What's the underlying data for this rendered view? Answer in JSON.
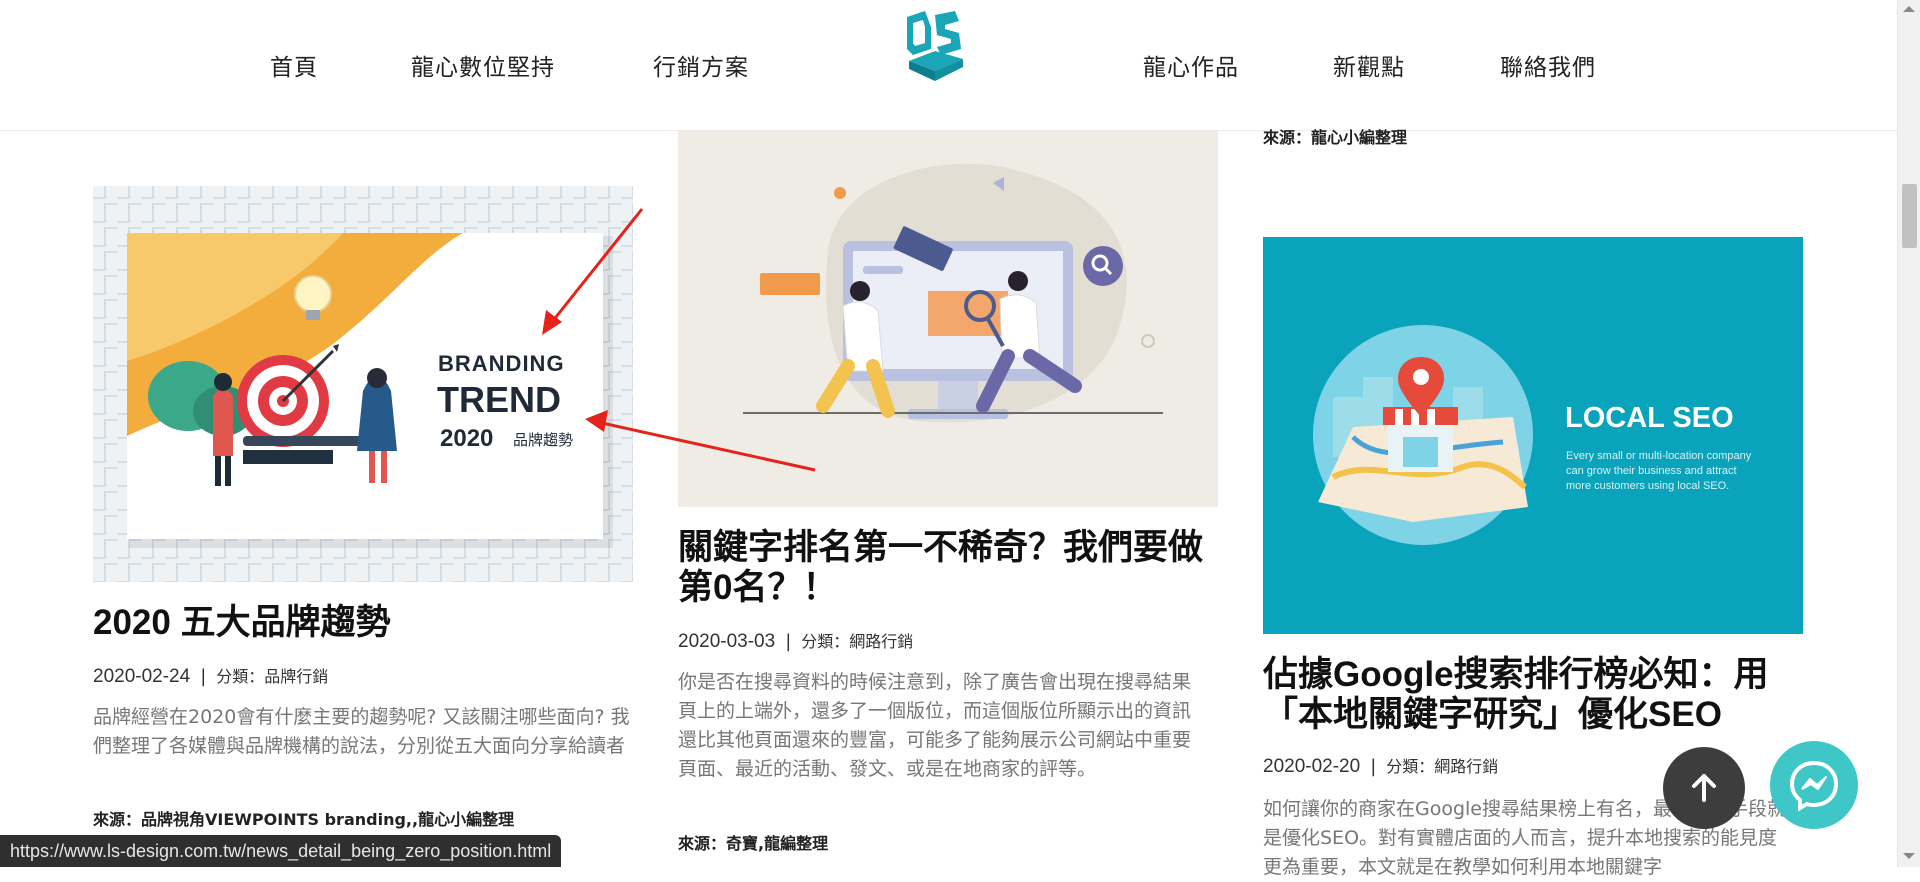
{
  "nav": {
    "left": [
      "首頁",
      "龍心數位堅持",
      "行銷方案"
    ],
    "right": [
      "龍心作品",
      "新觀點",
      "聯絡我們"
    ]
  },
  "prev_source": "來源：龍心小編整理",
  "articles": [
    {
      "title": "2020 五大品牌趨勢",
      "date": "2020-02-24",
      "category": "分類：品牌行銷",
      "excerpt": "品牌經營在2020會有什麼主要的趨勢呢? 又該關注哪些面向? 我們整理了各媒體與品牌機構的說法，分別從五大面向分享給讀者",
      "source": "來源：品牌視角VIEWPOINTS branding,,龍心小編整理",
      "image_text": {
        "line1": "BRANDING",
        "line2": "TREND",
        "line3": "2020",
        "line3b": "品牌趨勢"
      }
    },
    {
      "title": "關鍵字排名第一不稀奇？我們要做第0名？！",
      "date": "2020-03-03",
      "category": "分類：網路行銷",
      "excerpt": "你是否在搜尋資料的時候注意到，除了廣告會出現在搜尋結果頁上的上端外，還多了一個版位，而這個版位所顯示出的資訊還比其他頁面還來的豐富，可能多了能夠展示公司網站中重要頁面、最近的活動、發文、或是在地商家的評等。",
      "source": "來源：奇寶,龍編整理"
    },
    {
      "title": "佔據Google搜索排行榜必知：用「本地關鍵字研究」優化SEO",
      "date": "2020-02-20",
      "category": "分類：網路行銷",
      "excerpt": "如何讓你的商家在Google搜尋結果榜上有名，最有效的手段就是優化SEO。對有實體店面的人而言，提升本地搜索的能見度更為重要，本文就是在教學如何利用本地關鍵字",
      "image_text": {
        "heading": "LOCAL SEO",
        "body1": "Every small or multi-location company",
        "body2": "can grow their business and attract",
        "body3": "more customers using local SEO."
      }
    }
  ],
  "status_url": "https://www.ls-design.com.tw/news_detail_being_zero_position.html",
  "colors": {
    "brand_teal": "#1aa6b7",
    "local_seo_bg": "#0aa3bc",
    "annotation_red": "#e5231b",
    "back_top_bg": "#3d3d3d",
    "messenger_bg": "#3fc6c6"
  },
  "icons": [
    "logo-icon",
    "arrow-up-icon",
    "messenger-icon"
  ]
}
